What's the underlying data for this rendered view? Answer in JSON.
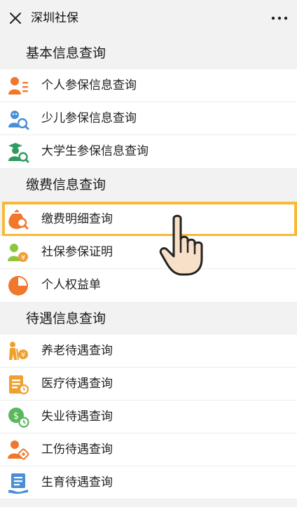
{
  "header": {
    "title": "深圳社保",
    "close_icon": "close-icon",
    "more_icon": "more-icon"
  },
  "sections": [
    {
      "title": "基本信息查询",
      "items": [
        {
          "label": "个人参保信息查询",
          "icon": "person-list-icon"
        },
        {
          "label": "少儿参保信息查询",
          "icon": "child-search-icon"
        },
        {
          "label": "大学生参保信息查询",
          "icon": "graduate-search-icon"
        }
      ]
    },
    {
      "title": "缴费信息查询",
      "items": [
        {
          "label": "缴费明细查询",
          "icon": "money-bag-search-icon",
          "highlighted": true
        },
        {
          "label": "社保参保证明",
          "icon": "person-yuan-icon"
        },
        {
          "label": "个人权益单",
          "icon": "pie-chart-icon"
        }
      ]
    },
    {
      "title": "待遇信息查询",
      "items": [
        {
          "label": "养老待遇查询",
          "icon": "elderly-yuan-icon"
        },
        {
          "label": "医疗待遇查询",
          "icon": "medical-record-icon"
        },
        {
          "label": "失业待遇查询",
          "icon": "money-clock-icon"
        },
        {
          "label": "工伤待遇查询",
          "icon": "injury-person-icon"
        },
        {
          "label": "生育待遇查询",
          "icon": "document-hand-icon"
        }
      ]
    }
  ],
  "pointer": {
    "icon": "hand-pointer-icon"
  },
  "colors": {
    "highlight": "#f7b938",
    "orange": "#f0772b",
    "green": "#5bb75b",
    "blue": "#4a8fd6"
  }
}
